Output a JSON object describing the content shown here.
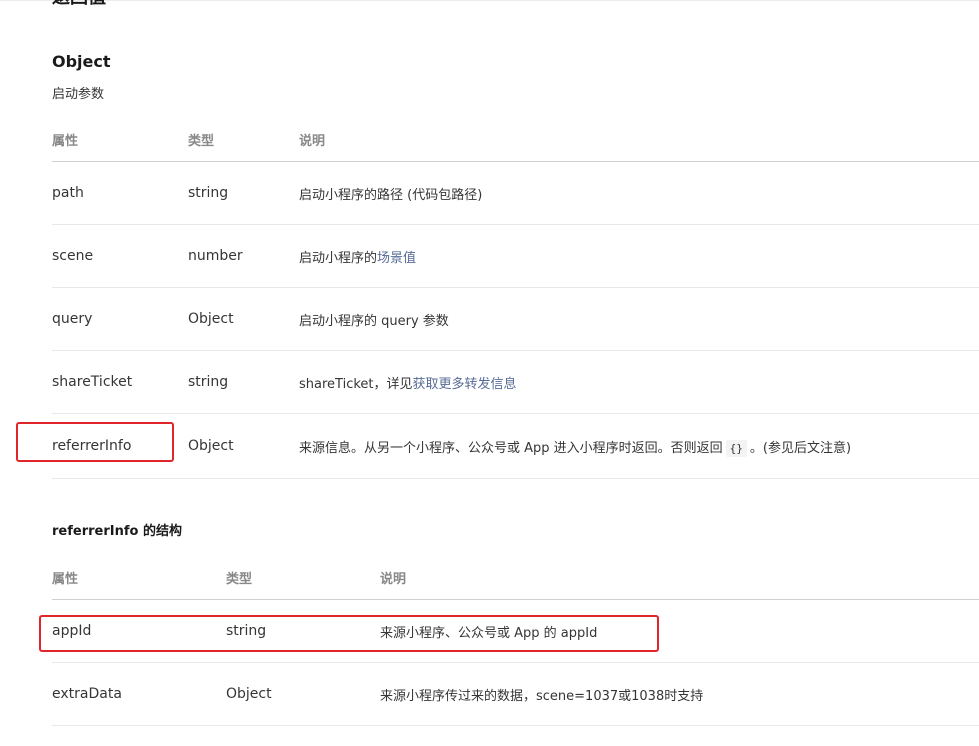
{
  "section_heading": "返回值",
  "object": {
    "title": "Object",
    "description": "启动参数",
    "headers": {
      "attr": "属性",
      "type": "类型",
      "desc": "说明"
    },
    "rows": [
      {
        "attr": "path",
        "type": "string",
        "desc": "启动小程序的路径 (代码包路径)"
      },
      {
        "attr": "scene",
        "type": "number",
        "desc": "启动小程序的",
        "link": "场景值"
      },
      {
        "attr": "query",
        "type": "Object",
        "desc": "启动小程序的 query 参数"
      },
      {
        "attr": "shareTicket",
        "type": "string",
        "desc": "shareTicket，详见",
        "link": "获取更多转发信息"
      },
      {
        "attr": "referrerInfo",
        "type": "Object",
        "desc": "来源信息。从另一个小程序、公众号或 App 进入小程序时返回。否则返回",
        "code": "{}",
        "desc_after": "。(参见后文注意)"
      }
    ]
  },
  "referrer": {
    "title": "referrerInfo 的结构",
    "headers": {
      "attr": "属性",
      "type": "类型",
      "desc": "说明"
    },
    "rows": [
      {
        "attr": "appId",
        "type": "string",
        "desc": "来源小程序、公众号或 App 的 appId"
      },
      {
        "attr": "extraData",
        "type": "Object",
        "desc": "来源小程序传过来的数据，scene=1037或1038时支持"
      }
    ]
  },
  "colors": {
    "highlight": "#e0262b",
    "link": "#576b95"
  }
}
